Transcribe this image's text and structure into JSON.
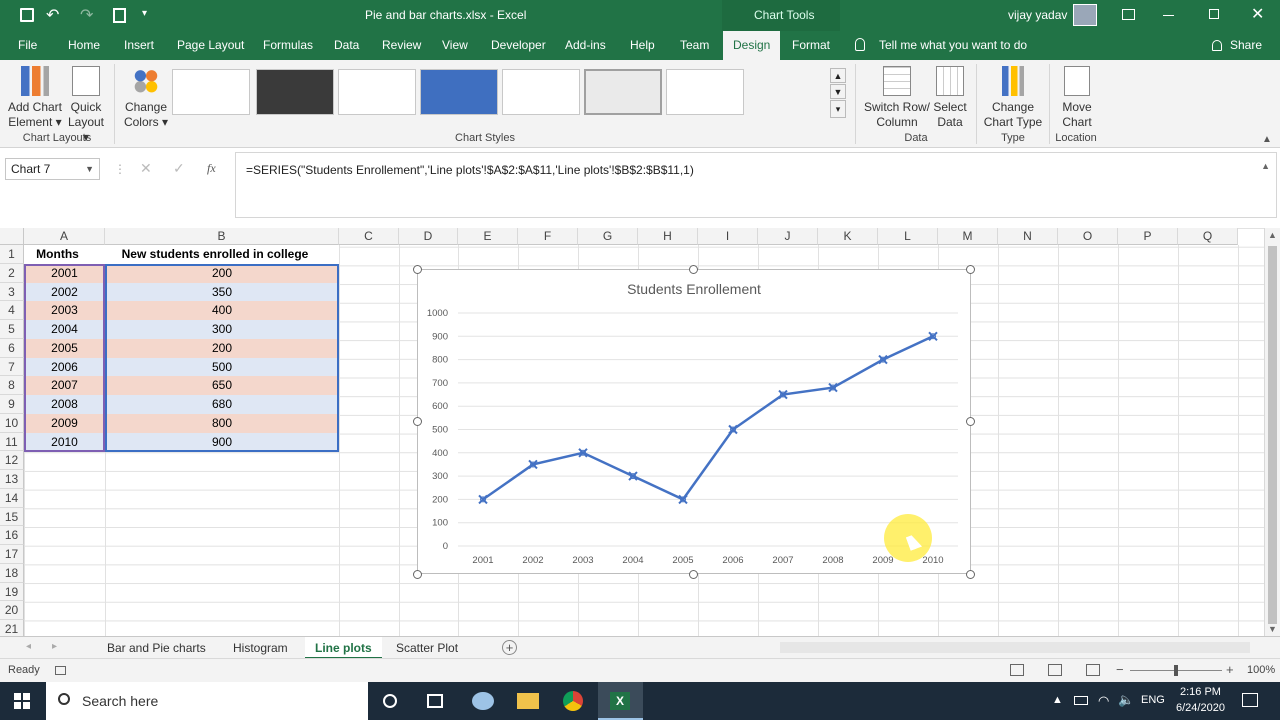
{
  "window": {
    "title": "Pie and bar charts.xlsx  -  Excel",
    "contextual": "Chart Tools",
    "user": "vijay yadav"
  },
  "tabs": [
    "File",
    "Home",
    "Insert",
    "Page Layout",
    "Formulas",
    "Data",
    "Review",
    "View",
    "Developer",
    "Add-ins",
    "Help",
    "Team",
    "Design",
    "Format"
  ],
  "active_tab": "Design",
  "tell_me": "Tell me what you want to do",
  "share": "Share",
  "ribbon": {
    "add_chart": [
      "Add Chart",
      "Element"
    ],
    "quick_layout": [
      "Quick",
      "Layout"
    ],
    "change_colors": [
      "Change",
      "Colors"
    ],
    "switch": [
      "Switch Row/",
      "Column"
    ],
    "select_data": [
      "Select",
      "Data"
    ],
    "change_type": [
      "Change",
      "Chart Type"
    ],
    "move_chart": [
      "Move",
      "Chart"
    ],
    "groups": {
      "layouts": "Chart Layouts",
      "styles": "Chart Styles",
      "data": "Data",
      "type": "Type",
      "location": "Location"
    }
  },
  "formula_bar": {
    "name_box": "Chart 7",
    "fx": "fx",
    "formula": "=SERIES(\"Students Enrollement\",'Line plots'!$A$2:$A$11,'Line plots'!$B$2:$B$11,1)"
  },
  "columns": [
    "A",
    "B",
    "C",
    "D",
    "E",
    "F",
    "G",
    "H",
    "I",
    "J",
    "K",
    "L",
    "M",
    "N",
    "O",
    "P",
    "Q"
  ],
  "rows": [
    "1",
    "2",
    "3",
    "4",
    "5",
    "6",
    "7",
    "8",
    "9",
    "10",
    "11",
    "12",
    "13",
    "14",
    "15",
    "16",
    "17",
    "18",
    "19",
    "20",
    "21"
  ],
  "table": {
    "headers": [
      "Months",
      "New students enrolled in college"
    ],
    "rows": [
      [
        "2001",
        "200"
      ],
      [
        "2002",
        "350"
      ],
      [
        "2003",
        "400"
      ],
      [
        "2004",
        "300"
      ],
      [
        "2005",
        "200"
      ],
      [
        "2006",
        "500"
      ],
      [
        "2007",
        "650"
      ],
      [
        "2008",
        "680"
      ],
      [
        "2009",
        "800"
      ],
      [
        "2010",
        "900"
      ]
    ]
  },
  "sheets": [
    "Bar and Pie charts",
    "Histogram",
    "Line plots",
    "Scatter Plot"
  ],
  "active_sheet": "Line plots",
  "status": {
    "ready": "Ready",
    "zoom": "100%"
  },
  "taskbar": {
    "search": "Search here",
    "time": "2:16 PM",
    "date": "6/24/2020",
    "lang": "ENG"
  },
  "colors": {
    "excel_green": "#217346",
    "line": "#4472c4",
    "band_a": "#f4d7cc",
    "band_b": "#dfe7f4"
  },
  "chart_data": {
    "type": "line",
    "title": "Students Enrollement",
    "categories": [
      "2001",
      "2002",
      "2003",
      "2004",
      "2005",
      "2006",
      "2007",
      "2008",
      "2009",
      "2010"
    ],
    "values": [
      200,
      350,
      400,
      300,
      200,
      500,
      650,
      680,
      800,
      900
    ],
    "ylim": [
      0,
      1000
    ],
    "yticks": [
      "0",
      "100",
      "200",
      "300",
      "400",
      "500",
      "600",
      "700",
      "800",
      "900",
      "1000"
    ],
    "grid": true,
    "marker": "x"
  }
}
